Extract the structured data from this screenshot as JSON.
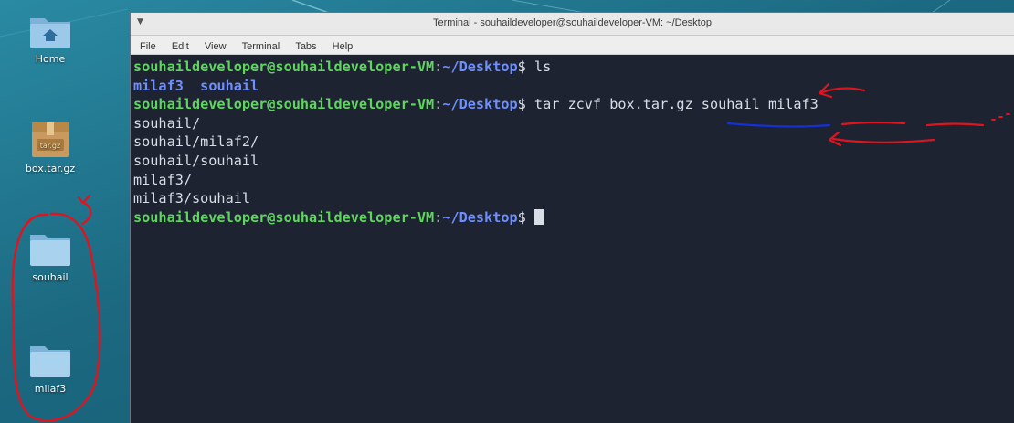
{
  "desktop": {
    "icons": [
      {
        "label": "Home",
        "icon": "home-folder-icon"
      },
      {
        "label": "box.tar.gz",
        "icon": "archive-icon",
        "badge": "tar.gz"
      },
      {
        "label": "souhail",
        "icon": "folder-icon"
      },
      {
        "label": "milaf3",
        "icon": "folder-icon"
      }
    ]
  },
  "terminal": {
    "title": "Terminal - souhaildeveloper@souhaildeveloper-VM: ~/Desktop",
    "window_menu_icon": "chevron-down-icon",
    "menu": [
      "File",
      "Edit",
      "View",
      "Terminal",
      "Tabs",
      "Help"
    ],
    "prompt_user": "souhaildeveloper@souhaildeveloper-VM",
    "prompt_sep": ":",
    "prompt_path": "~/Desktop",
    "prompt_end": "$",
    "cmd1": " ls",
    "ls_out": [
      "milaf3",
      "souhail"
    ],
    "cmd2": " tar zcvf box.tar.gz souhail milaf3",
    "tar_out": [
      "souhail/",
      "souhail/milaf2/",
      "souhail/souhail",
      "milaf3/",
      "milaf3/souhail"
    ]
  },
  "colors": {
    "prompt_user": "#5fd75f",
    "prompt_path": "#6f8fff",
    "terminal_bg": "#1d2331",
    "annotation_red": "#e0141e",
    "annotation_blue": "#1530d6"
  }
}
